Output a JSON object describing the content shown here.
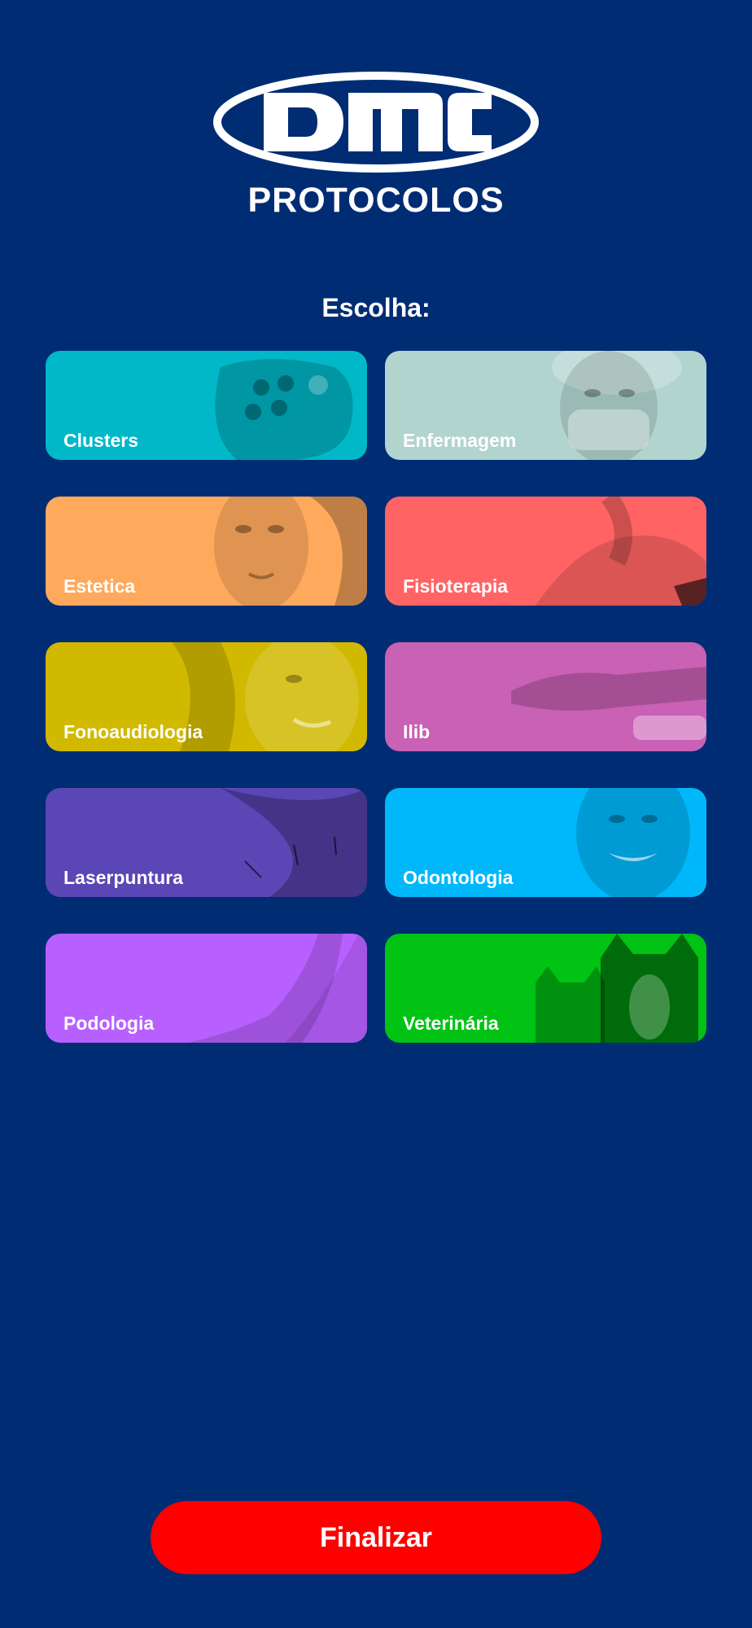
{
  "header": {
    "logo_text": "DMC",
    "subtitle": "PROTOCOLOS"
  },
  "prompt": "Escolha:",
  "categories": [
    {
      "label": "Clusters",
      "color": "#00b8c8",
      "image_icon": "cluster-device-icon"
    },
    {
      "label": "Enfermagem",
      "color": "#b1d4cf",
      "image_icon": "nurse-mask-icon"
    },
    {
      "label": "Estetica",
      "color": "#ffa95d",
      "image_icon": "face-portrait-icon"
    },
    {
      "label": "Fisioterapia",
      "color": "#ff6364",
      "image_icon": "knee-therapy-icon"
    },
    {
      "label": "Fonoaudiologia",
      "color": "#d1b900",
      "image_icon": "ear-listening-icon"
    },
    {
      "label": "Ilib",
      "color": "#c961b5",
      "image_icon": "wrist-device-icon"
    },
    {
      "label": "Laserpuntura",
      "color": "#5a46b4",
      "image_icon": "acupuncture-needles-icon"
    },
    {
      "label": "Odontologia",
      "color": "#00b7fa",
      "image_icon": "smile-teeth-icon"
    },
    {
      "label": "Podologia",
      "color": "#b860ff",
      "image_icon": "foot-icon"
    },
    {
      "label": "Veterinária",
      "color": "#00c314",
      "image_icon": "cat-dog-icon"
    }
  ],
  "footer": {
    "finalize_label": "Finalizar",
    "finalize_color": "#ff0000"
  },
  "colors": {
    "background": "#002c74",
    "text": "#ffffff"
  }
}
